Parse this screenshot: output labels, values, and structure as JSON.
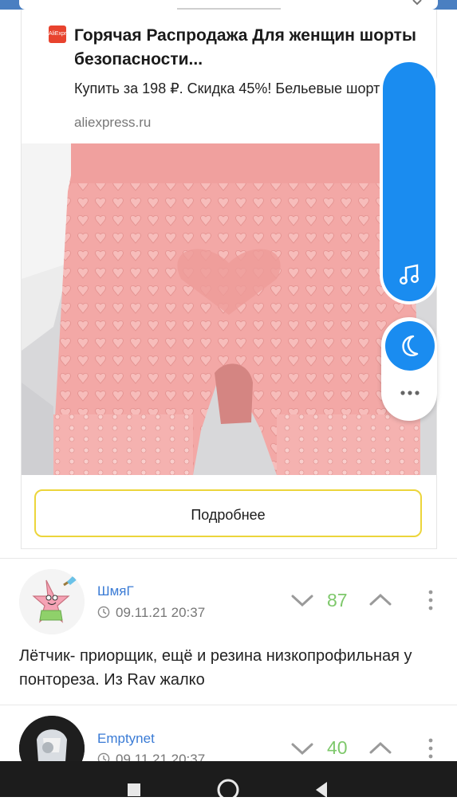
{
  "ad": {
    "logo_text": "AliExpress",
    "title": "Горячая Распродажа Для женщин шорты безопасности...",
    "description": "Купить за 198 ₽. Скидка 45%! Бельевые шорты",
    "domain": "aliexpress.ru",
    "button_label": "Подробнее",
    "colors": {
      "button_border": "#ecd53b",
      "product": "#f2a4a3"
    }
  },
  "side_panel": {
    "icons": [
      "music-icon",
      "moon-icon",
      "more-dots-icon"
    ],
    "accent": "#1a8cf0"
  },
  "comments": [
    {
      "author": "ШмяГ",
      "time": "09.11.21 20:37",
      "score": "87",
      "text": "Лётчик- приорщик, ещё и резина низкопрофильная у понтореза. Из Rav жалко"
    },
    {
      "author": "Emptynet",
      "time": "09.11.21 20:37",
      "score": "40"
    }
  ],
  "colors": {
    "score": "#7ec86b",
    "author": "#3a7bd5",
    "nav": "#1c1c1c"
  }
}
